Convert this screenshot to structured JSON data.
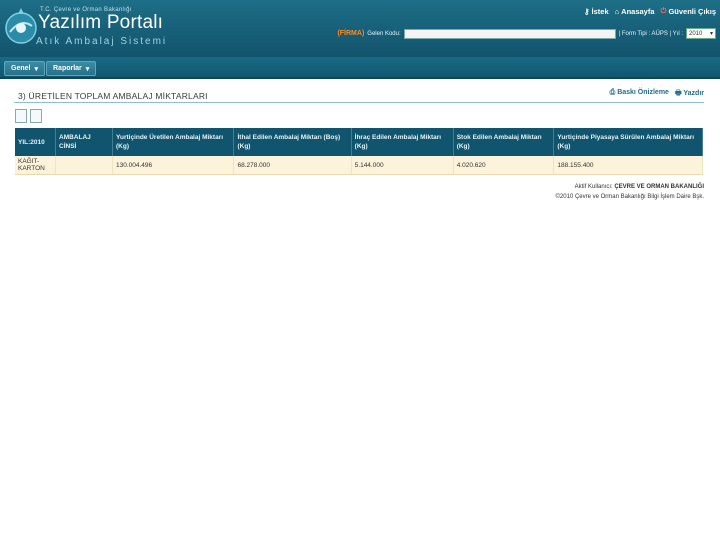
{
  "header": {
    "ministry": "T.C. Çevre ve Orman Bakanlığı",
    "title": "Yazılım Portalı",
    "subtitle": "Atık Ambalaj Sistemi",
    "links": [
      "İstek",
      "Anasayfa",
      "Güvenli Çıkış"
    ],
    "firm_name": "(FİRMA)",
    "cu_label": "Gelen Kodu:",
    "form_type": "| Form Tipi : AÜPS | Yıl :",
    "year": "2010"
  },
  "menu": {
    "items": [
      "Genel",
      "Raporlar"
    ]
  },
  "page": {
    "title": "3) ÜRETİLEN TOPLAM AMBALAJ MİKTARLARI",
    "print_preview": "Baskı Önizleme",
    "print": "Yazdır"
  },
  "table": {
    "headers": [
      "YIL:2010",
      "AMBALAJ CİNSİ",
      "Yurtiçinde Üretilen Ambalaj Miktarı (Kg)",
      "İthal Edilen Ambalaj Miktarı (Boş) (Kg)",
      "İhraç Edilen Ambalaj Miktarı (Kg)",
      "Stok Edilen Ambalaj Miktarı (Kg)",
      "Yurtiçinde Piyasaya Sürülen Ambalaj Miktarı (Kg)"
    ],
    "rows": [
      [
        "KAĞIT-KARTON",
        "",
        "130.004.496",
        "68.278.000",
        "5.144.000",
        "4.020.620",
        "188.155.400"
      ]
    ]
  },
  "footer": {
    "line1_prefix": "Aktif Kullanıcı:",
    "line1_user": "ÇEVRE VE ORMAN BAKANLIĞI",
    "line2": "©2010 Çevre ve Orman Bakanlığı Bilgi İşlem Daire Bşk."
  },
  "colors": {
    "header": "#1a6680",
    "accent": "#ff8a1c",
    "row": "#fdf3db"
  }
}
